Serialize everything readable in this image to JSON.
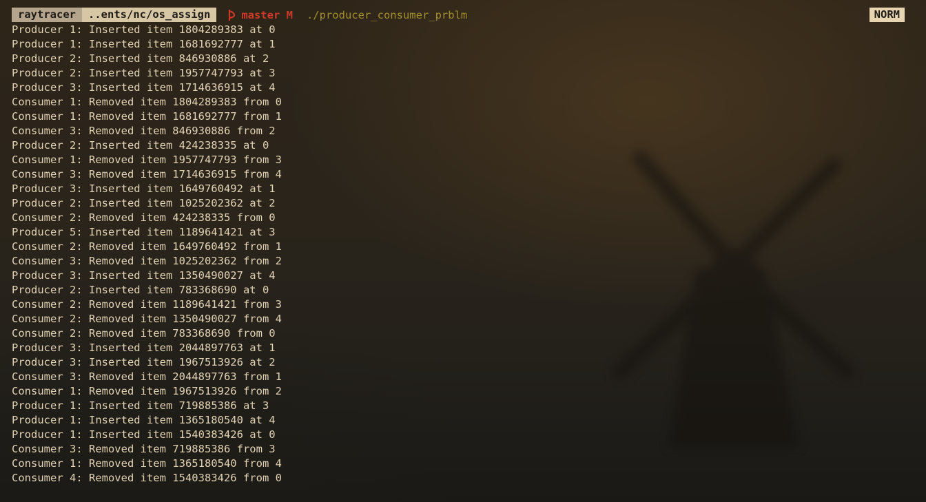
{
  "prompt": {
    "dir_primary": "raytracer",
    "dir_path": "..ents/nc/os_assign",
    "branch_icon": "git-branch-icon",
    "branch": "master M",
    "command": "./producer_consumer_prblm",
    "mode": "NORM"
  },
  "colors": {
    "background": "#24211b",
    "text": "#e2d3b4",
    "branch": "#cc3a2a",
    "command": "#a38e2d",
    "badge": "#e7d5b1"
  },
  "output_lines": [
    "Producer 1: Inserted item 1804289383 at 0",
    "Producer 1: Inserted item 1681692777 at 1",
    "Producer 2: Inserted item 846930886 at 2",
    "Producer 2: Inserted item 1957747793 at 3",
    "Producer 3: Inserted item 1714636915 at 4",
    "Consumer 1: Removed item 1804289383 from 0",
    "Consumer 1: Removed item 1681692777 from 1",
    "Consumer 3: Removed item 846930886 from 2",
    "Producer 2: Inserted item 424238335 at 0",
    "Consumer 1: Removed item 1957747793 from 3",
    "Consumer 3: Removed item 1714636915 from 4",
    "Producer 3: Inserted item 1649760492 at 1",
    "Producer 2: Inserted item 1025202362 at 2",
    "Consumer 2: Removed item 424238335 from 0",
    "Producer 5: Inserted item 1189641421 at 3",
    "Consumer 2: Removed item 1649760492 from 1",
    "Consumer 3: Removed item 1025202362 from 2",
    "Producer 3: Inserted item 1350490027 at 4",
    "Producer 2: Inserted item 783368690 at 0",
    "Consumer 2: Removed item 1189641421 from 3",
    "Consumer 2: Removed item 1350490027 from 4",
    "Consumer 2: Removed item 783368690 from 0",
    "Producer 3: Inserted item 2044897763 at 1",
    "Producer 3: Inserted item 1967513926 at 2",
    "Consumer 3: Removed item 2044897763 from 1",
    "Consumer 1: Removed item 1967513926 from 2",
    "Producer 1: Inserted item 719885386 at 3",
    "Producer 1: Inserted item 1365180540 at 4",
    "Producer 1: Inserted item 1540383426 at 0",
    "Consumer 3: Removed item 719885386 from 3",
    "Consumer 1: Removed item 1365180540 from 4",
    "Consumer 4: Removed item 1540383426 from 0"
  ]
}
